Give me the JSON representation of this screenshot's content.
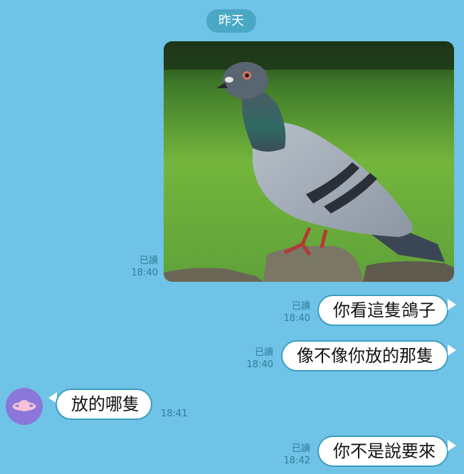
{
  "chat": {
    "date_separator": "昨天",
    "colors": {
      "background": "#6fc3e6",
      "bubble": "#ffffff",
      "pill": "#4aa8c6",
      "avatar": "#8a77d9"
    },
    "messages": [
      {
        "type": "image",
        "sender": "me",
        "content": "pigeon-photo",
        "read": "已讀",
        "time": "18:40"
      },
      {
        "type": "text",
        "sender": "me",
        "text": "你看這隻鴿子",
        "read": "已讀",
        "time": "18:40"
      },
      {
        "type": "text",
        "sender": "me",
        "text": "像不像你放的那隻",
        "read": "已讀",
        "time": "18:40"
      },
      {
        "type": "text",
        "sender": "other",
        "text": "放的哪隻",
        "time": "18:41",
        "avatar_icon": "planet-icon"
      },
      {
        "type": "text",
        "sender": "me",
        "text": "你不是說要來",
        "read": "已讀",
        "time": "18:42"
      }
    ]
  }
}
